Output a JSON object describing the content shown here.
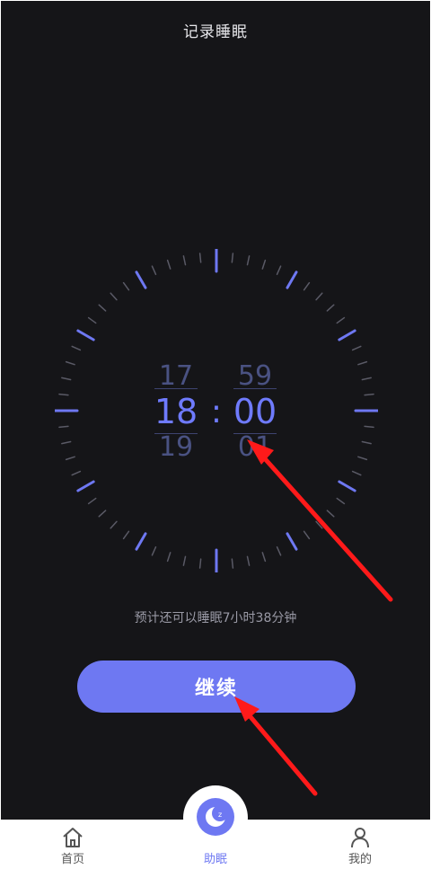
{
  "header": {
    "title": "记录睡眠"
  },
  "picker": {
    "hour_prev": "17",
    "hour_current": "18",
    "hour_next": "19",
    "separator": ":",
    "minute_prev": "59",
    "minute_current": "00",
    "minute_next": "01"
  },
  "estimate_text": "预计还可以睡眠7小时38分钟",
  "continue_label": "继续",
  "tabbar": {
    "items": [
      {
        "label": "首页",
        "icon": "home-icon"
      },
      {
        "label": "助眠",
        "icon": "sleep-moon-icon"
      },
      {
        "label": "我的",
        "icon": "profile-icon"
      }
    ]
  },
  "colors": {
    "background": "#151518",
    "accent": "#6e78f2",
    "tick": "#5a5a66",
    "annotation_arrow": "#ff1a1a"
  }
}
